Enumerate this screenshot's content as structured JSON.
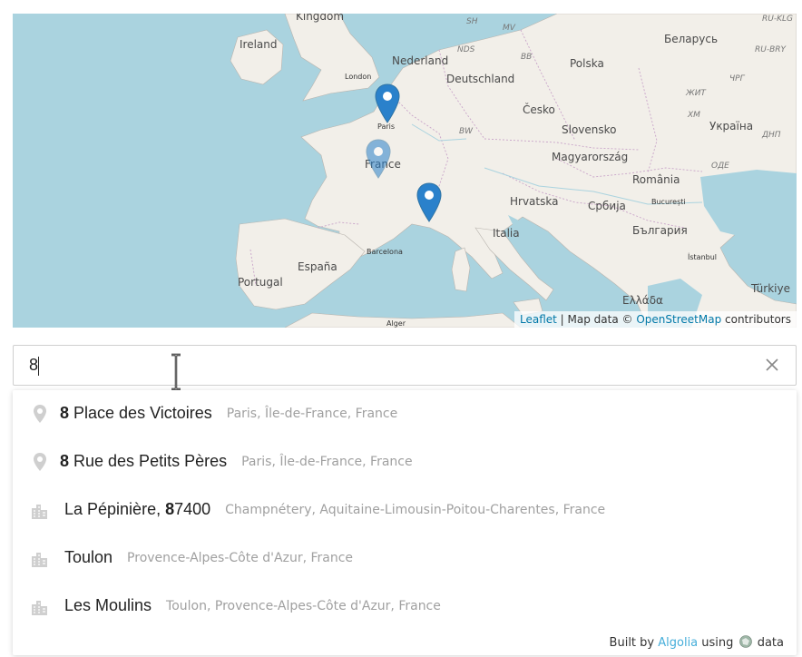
{
  "map": {
    "labels": {
      "kingdom": "Kingdom",
      "ireland": "Ireland",
      "nederland": "Nederland",
      "london": "London",
      "deutschland": "Deutschland",
      "polska": "Polska",
      "belarus": "Беларусь",
      "paris": "Paris",
      "cesko": "Česko",
      "ukraina": "Україна",
      "slovensko": "Slovensko",
      "france": "France",
      "magyarorszag": "Magyarország",
      "romania": "România",
      "bucuresti": "București",
      "hrvatska": "Hrvatska",
      "srbija": "Србија",
      "espana": "España",
      "italia": "Italia",
      "bulgaria": "България",
      "barcelona": "Barcelona",
      "portugal": "Portugal",
      "istanbul": "İstanbul",
      "turkiye": "Türkiye",
      "ellada": "Ελλάδα",
      "alger": "Alger",
      "sh": "SH",
      "mv": "MV",
      "nds": "NDS",
      "bb": "BB",
      "bw": "BW",
      "ru_klg": "RU-KLG",
      "ru_bry": "RU-BRY",
      "chg": "ЧРГ",
      "zhit": "ЖИТ",
      "khm": "ХМ",
      "dnp": "ДНП",
      "ode": "ОДЕ"
    },
    "markers": [
      "paris-marker",
      "france-marker",
      "toulon-marker"
    ],
    "attribution": {
      "leaflet": "Leaflet",
      "separator": "| Map data ©",
      "osm": "OpenStreetMap",
      "suffix": "contributors"
    },
    "colors": {
      "water": "#aad3df",
      "land": "#f2efe9",
      "marker_dark": "#2a81cb",
      "marker_light": "#7eb3dd"
    }
  },
  "search": {
    "value": "8",
    "clear_icon": "close-icon"
  },
  "suggestions": [
    {
      "type": "address",
      "icon": "pin-icon",
      "bold": "8",
      "rest": " Place des Victoires",
      "address": "Paris, Île-de-France, France"
    },
    {
      "type": "address",
      "icon": "pin-icon",
      "bold": "8",
      "rest": " Rue des Petits Pères",
      "address": "Paris, Île-de-France, France"
    },
    {
      "type": "city",
      "icon": "city-icon",
      "pre": "La Pépinière, ",
      "bold": "8",
      "rest": "7400",
      "address": "Champnétery, Aquitaine-Limousin-Poitou-Charentes, France"
    },
    {
      "type": "city",
      "icon": "city-icon",
      "rest": "Toulon",
      "address": "Provence-Alpes-Côte d'Azur, France"
    },
    {
      "type": "city",
      "icon": "city-icon",
      "rest": "Les Moulins",
      "address": "Toulon, Provence-Alpes-Côte d'Azur, France"
    }
  ],
  "footer": {
    "built_by": "Built by",
    "algolia": "Algolia",
    "using": "using",
    "data": "data"
  }
}
